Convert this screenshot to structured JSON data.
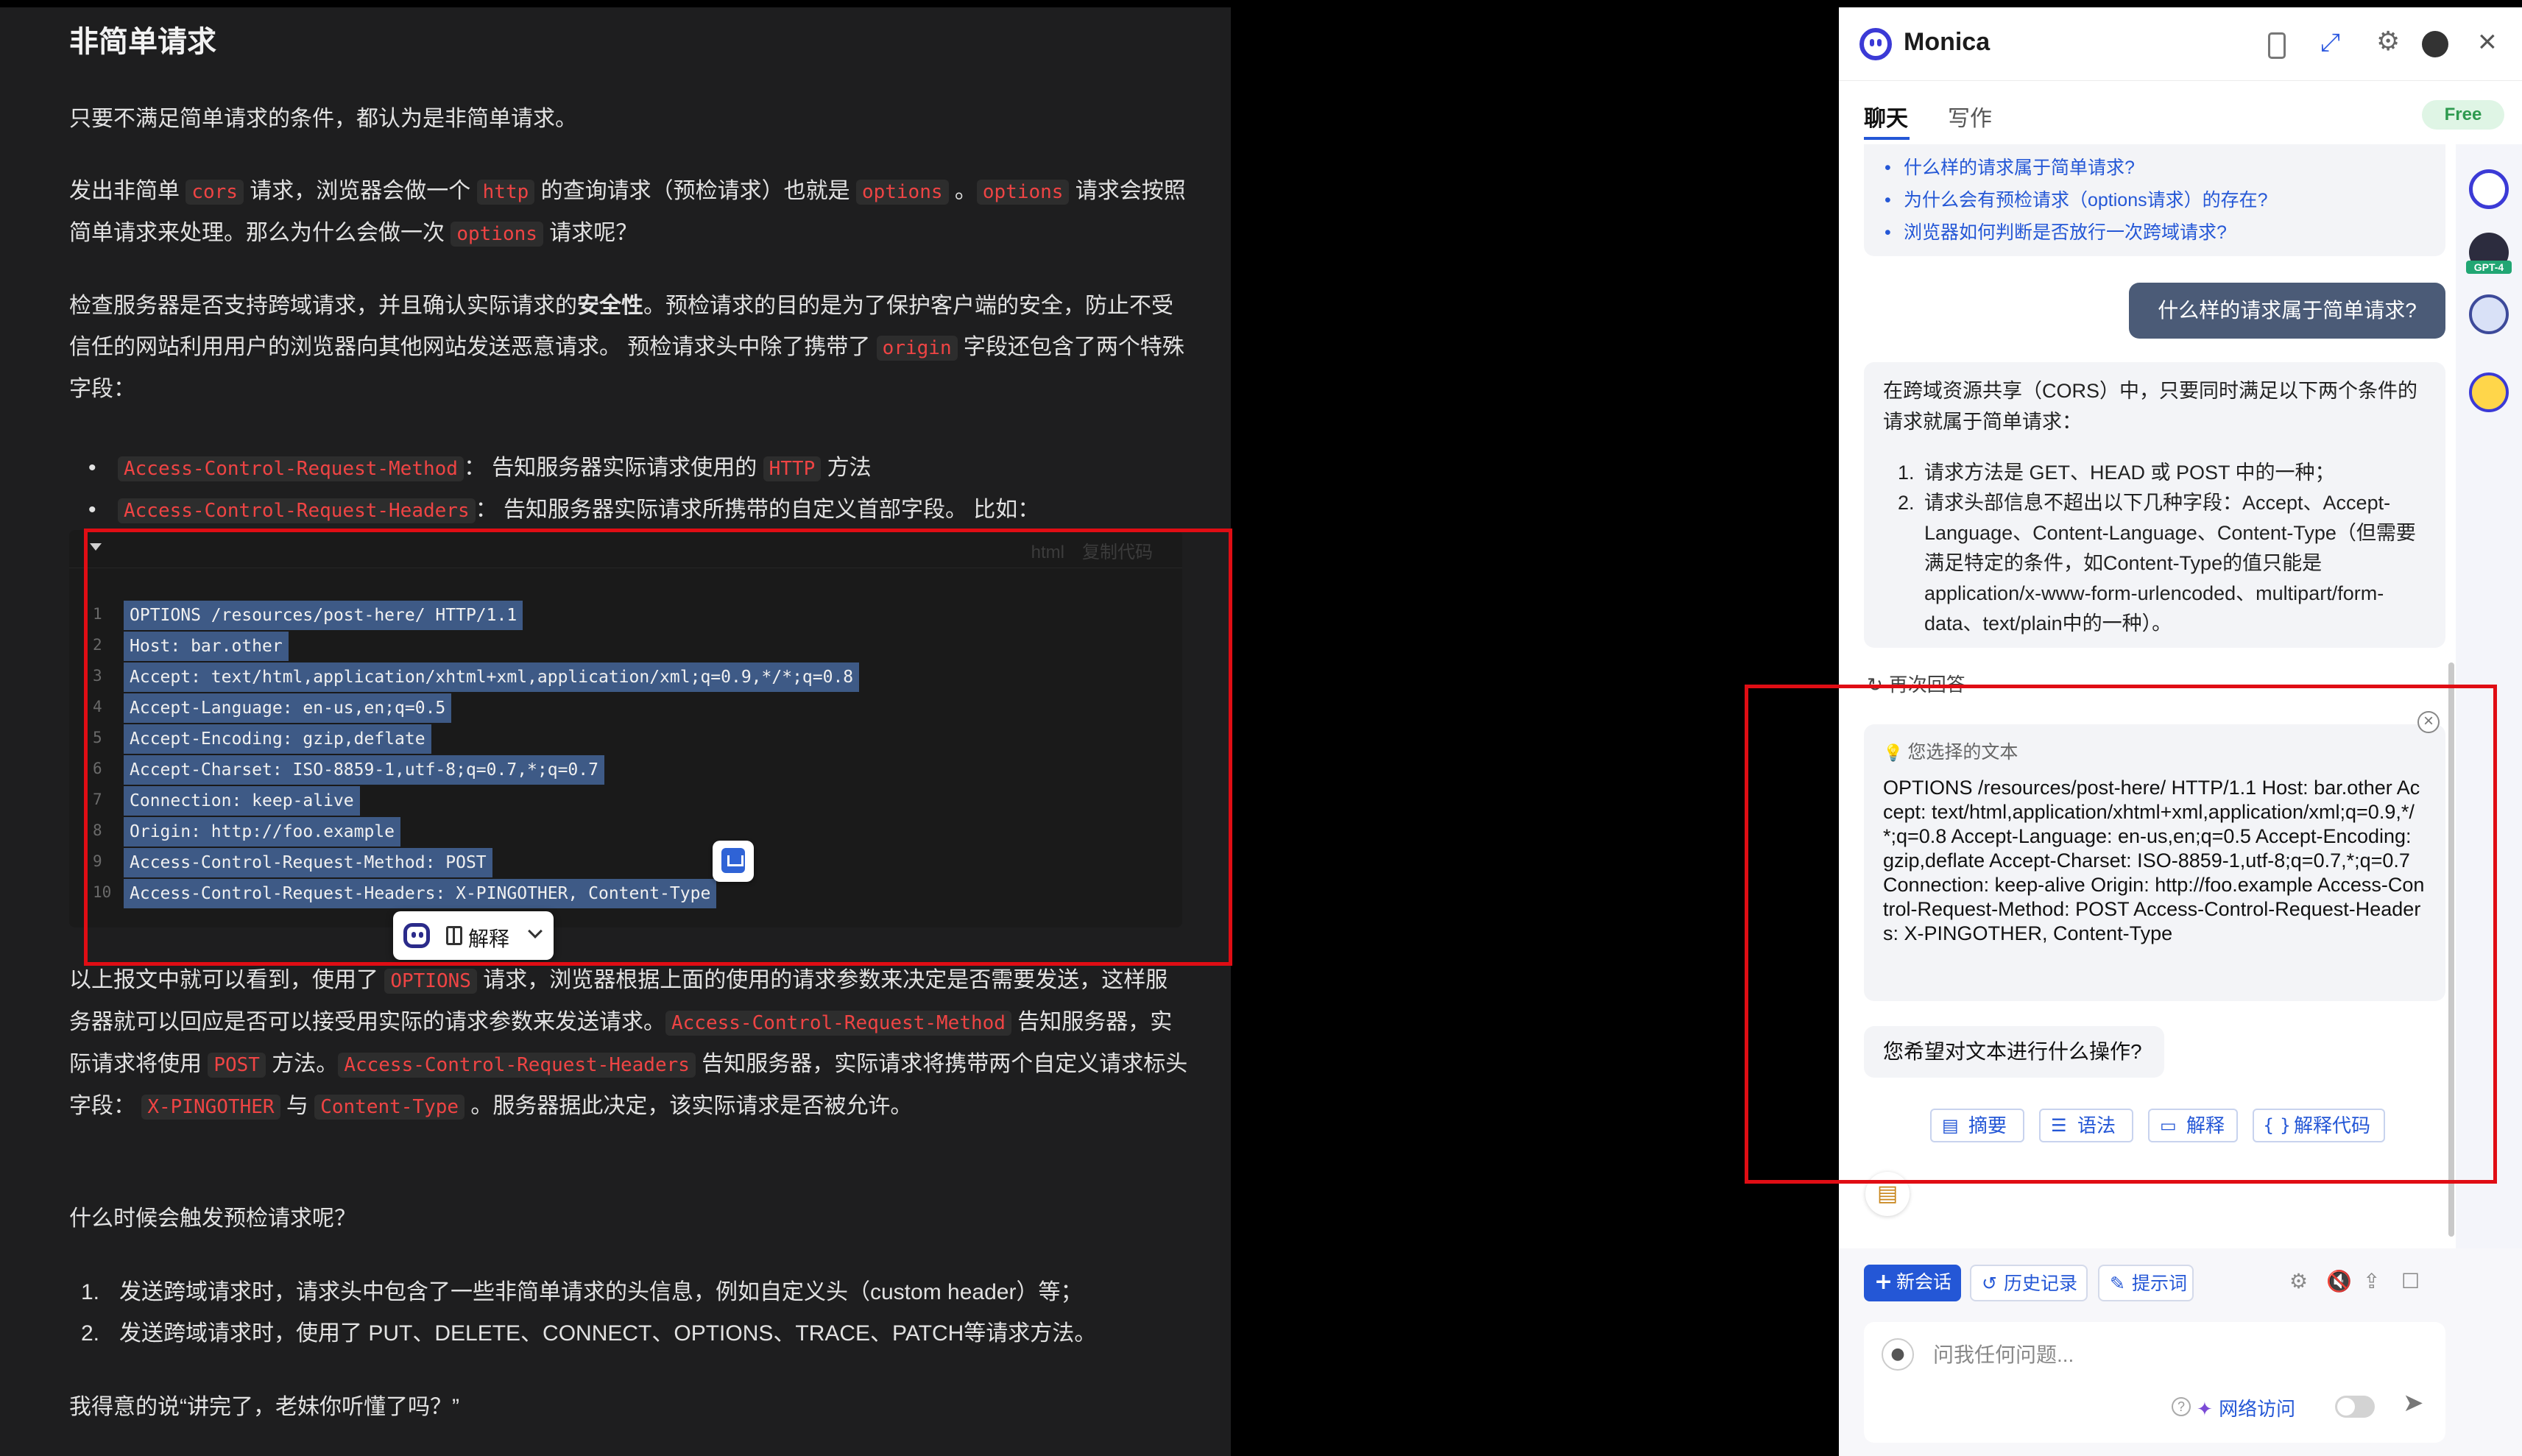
{
  "article": {
    "heading": "非简单请求",
    "p1": "只要不满足简单请求的条件，都认为是非简单请求。",
    "p2": {
      "a": "发出非简单 ",
      "code1": "cors",
      "b": " 请求，浏览器会做一个 ",
      "code2": "http",
      "c": " 的查询请求（预检请求）也就是 ",
      "code3": "options",
      "d": " 。",
      "code4": "options",
      "e": " 请求会按照简单请求来处理。那么为什么会做一次 ",
      "code5": "options",
      "f": " 请求呢？"
    },
    "p3": {
      "a": "检查服务器是否支持跨域请求，并且确认实际请求的",
      "strong": "安全性",
      "b": "。预检请求的目的是为了保护客户端的安全，防止不受信任的网站利用用户的浏览器向其他网站发送恶意请求。 预检请求头中除了携带了 ",
      "code": "origin",
      "c": " 字段还包含了两个特殊字段："
    },
    "bullets": [
      {
        "code": "Access-Control-Request-Method",
        "a": "： 告知服务器实际请求使用的 ",
        "code2": "HTTP",
        "b": " 方法"
      },
      {
        "code": "Access-Control-Request-Headers",
        "a": "： 告知服务器实际请求所携带的自定义首部字段。 比如：",
        "code2": "",
        "b": ""
      }
    ],
    "codeblock": {
      "lang": "html",
      "copy_label": "复制代码",
      "lines": [
        {
          "n": "1",
          "text": "OPTIONS /resources/post-here/ HTTP/1.1"
        },
        {
          "n": "2",
          "text": "Host: bar.other"
        },
        {
          "n": "3",
          "text": "Accept: text/html,application/xhtml+xml,application/xml;q=0.9,*/*;q=0.8"
        },
        {
          "n": "4",
          "text": "Accept-Language: en-us,en;q=0.5"
        },
        {
          "n": "5",
          "text": "Accept-Encoding: gzip,deflate"
        },
        {
          "n": "6",
          "text": "Accept-Charset: ISO-8859-1,utf-8;q=0.7,*;q=0.7"
        },
        {
          "n": "7",
          "text": "Connection: keep-alive"
        },
        {
          "n": "8",
          "text": "Origin: http://foo.example"
        },
        {
          "n": "9",
          "text": "Access-Control-Request-Method: POST"
        },
        {
          "n": "10",
          "text": "Access-Control-Request-Headers: X-PINGOTHER, Content-Type"
        }
      ]
    },
    "selection_toolbar": {
      "label": "解释"
    },
    "p4": {
      "a": "以上报文中就可以看到，使用了 ",
      "code1": "OPTIONS",
      "b": " 请求，浏览器根据上面的使用的请求参数来决定是否需要发送，这样服务器就可以回应是否可以接受用实际的请求参数来发送请求。",
      "code2": "Access-Control-Request-Method",
      "c": " 告知服务器，实际请求将使用 ",
      "code3": "POST",
      "d": " 方法。",
      "code4": "Access-Control-Request-Headers",
      "e": " 告知服务器，实际请求将携带两个自定义请求标头字段： ",
      "code5": "X-PINGOTHER",
      "f": " 与 ",
      "code6": "Content-Type",
      "g": " 。服务器据此决定，该实际请求是否被允许。"
    },
    "p5": "什么时候会触发预检请求呢？",
    "steps": [
      {
        "n": "1.",
        "text": "发送跨域请求时，请求头中包含了一些非简单请求的头信息，例如自定义头（custom header）等；"
      },
      {
        "n": "2.",
        "text": "发送跨域请求时，使用了 PUT、DELETE、CONNECT、OPTIONS、TRACE、PATCH等请求方法。"
      }
    ],
    "p6": "我得意的说“讲完了，老妹你听懂了吗？”"
  },
  "panel": {
    "brand": "Monica",
    "tabs": [
      "聊天",
      "写作"
    ],
    "badge": "Free",
    "suggestions": [
      "什么样的请求属于简单请求?",
      "为什么会有预检请求（options请求）的存在?",
      "浏览器如何判断是否放行一次跨域请求?"
    ],
    "user_message": "什么样的请求属于简单请求?",
    "ai_answer": {
      "intro": "在跨域资源共享（CORS）中，只要同时满足以下两个条件的请求就属于简单请求：",
      "items": [
        {
          "n": "1.",
          "text": "请求方法是 GET、HEAD 或 POST 中的一种；"
        },
        {
          "n": "2.",
          "text": "请求头部信息不超出以下几种字段：Accept、Accept-Language、Content-Language、Content-Type（但需要满足特定的条件，如Content-Type的值只能是application/x-www-form-urlencoded、multipart/form-data、text/plain中的一种）。"
        }
      ]
    },
    "retry_label": "再次回答",
    "selected": {
      "caption": "您选择的文本",
      "text": "OPTIONS /resources/post-here/ HTTP/1.1 Host: bar.other Accept: text/html,application/xhtml+xml,application/xml;q=0.9,*/*;q=0.8 Accept-Language: en-us,en;q=0.5 Accept-Encoding: gzip,deflate Accept-Charset: ISO-8859-1,utf-8;q=0.7,*;q=0.7 Connection: keep-alive Origin: http://foo.example Access-Control-Request-Method: POST Access-Control-Request-Headers: X-PINGOTHER, Content-Type"
    },
    "question": "您希望对文本进行什么操作?",
    "actions": {
      "summary": "摘要",
      "grammar": "语法",
      "explain": "解释",
      "explain_code": "解释代码"
    },
    "bots": {
      "gpt4_badge": "GPT-4"
    },
    "bottom": {
      "new_chat": "新会话",
      "history": "历史记录",
      "prompts": "提示词",
      "input_placeholder": "问我任何问题...",
      "web_access": "网络访问"
    }
  }
}
